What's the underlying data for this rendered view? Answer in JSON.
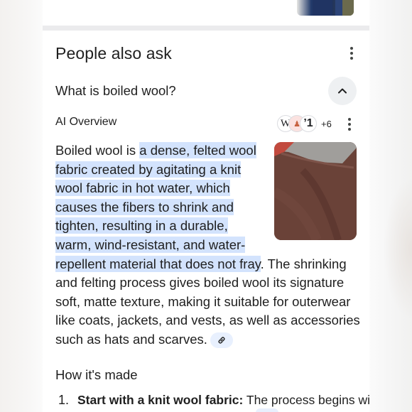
{
  "paa": {
    "title": "People also ask",
    "question": "What is boiled wool?"
  },
  "ai_overview": {
    "label": "AI Overview",
    "source_count_more": "+6",
    "sources": [
      {
        "icon": "wikipedia-icon",
        "glyph": "W"
      },
      {
        "icon": "source-logo-icon",
        "glyph": "♟"
      },
      {
        "icon": "source-logo-icon-2",
        "glyph": "ʼ1"
      }
    ],
    "highlight_color": "#d3e3fd",
    "paragraph": {
      "line1_plain": "Boiled wool is ",
      "line1_hl": "a dense, felted wool",
      "line2_hl": "fabric created by agitating a knit",
      "line3_hl": "wool fabric in hot water, which",
      "line4_hl": "causes the fibers to shrink and",
      "line5_hl": "tighten, resulting in a durable,",
      "line6_hl": "warm, wind-resistant, and water-",
      "line7_hl": "repellent material that does not fray",
      "line7_plain": ". The shrinking",
      "line8": "and felting process gives boiled wool its signature",
      "line9": "soft, matte texture, making it suitable for outerwear",
      "line10": "like coats, jackets, and vests, as well as accessories",
      "line11": "such as hats and scarves."
    },
    "section_heading": "How it's made",
    "list": [
      {
        "number": "1.",
        "bold": "Start with a knit wool fabric:",
        "text": " The process begins with"
      }
    ]
  }
}
